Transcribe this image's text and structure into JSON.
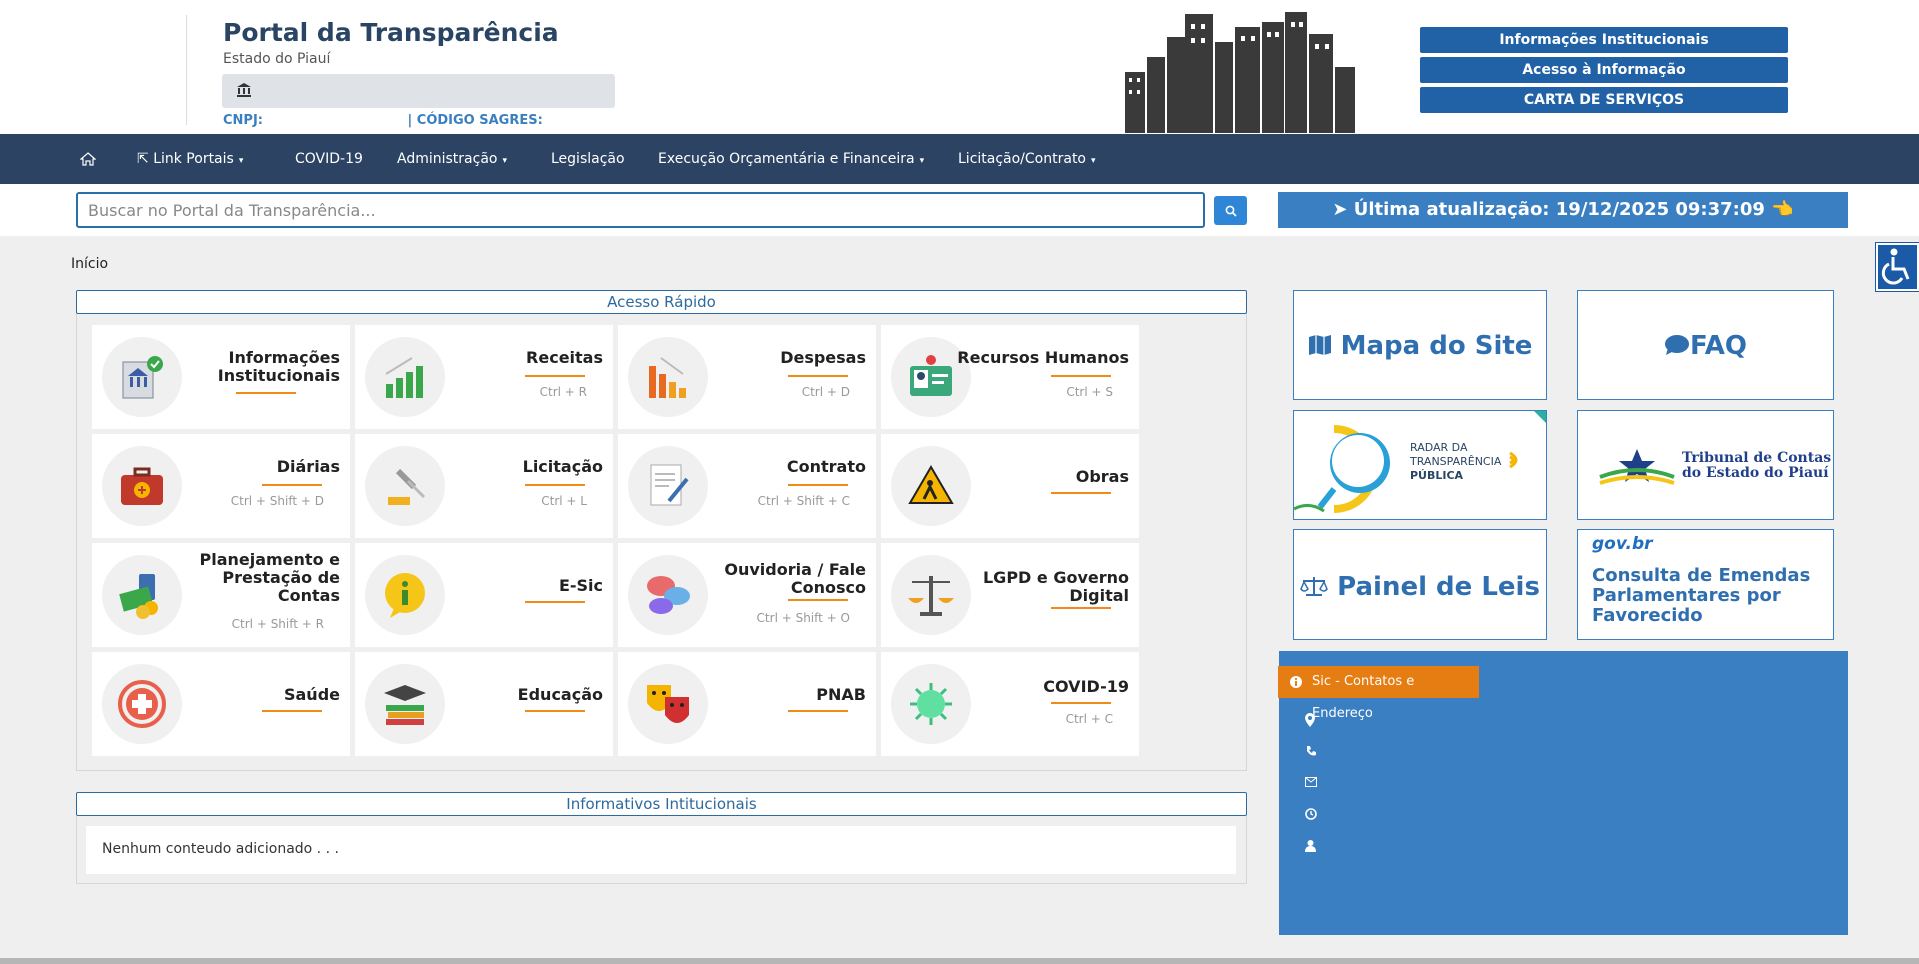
{
  "header": {
    "title": "Portal da Transparência",
    "subtitle": "Estado do Piauí",
    "cnpj_label": "CNPJ:",
    "sagres_label": "| CÓDIGO SAGRES:",
    "buttons": [
      "Informações Institucionais",
      "Acesso à Informação",
      "CARTA DE SERVIÇOS"
    ]
  },
  "nav": {
    "items": [
      {
        "label": "Link Portais"
      },
      {
        "label": "COVID-19"
      },
      {
        "label": "Administração"
      },
      {
        "label": "Legislação"
      },
      {
        "label": "Execução Orçamentária e Financeira"
      },
      {
        "label": "Licitação/Contrato"
      }
    ]
  },
  "search": {
    "placeholder": "Buscar no Portal da Transparência...",
    "update_text": "➤ Última atualização: 19/12/2025 09:37:09 👈"
  },
  "breadcrumb": "Início",
  "quick_access": {
    "title": "Acesso Rápido",
    "cards": [
      {
        "label": "Informações Institucionais",
        "shortcut": "",
        "icon": "building-check-icon"
      },
      {
        "label": "Receitas",
        "shortcut": "Ctrl + R",
        "icon": "growth-chart-icon"
      },
      {
        "label": "Despesas",
        "shortcut": "Ctrl + D",
        "icon": "decline-chart-icon"
      },
      {
        "label": "Recursos Humanos",
        "shortcut": "Ctrl + S",
        "icon": "id-badge-icon"
      },
      {
        "label": "Diárias",
        "shortcut": "Ctrl + Shift + D",
        "icon": "suitcase-icon"
      },
      {
        "label": "Licitação",
        "shortcut": "Ctrl + L",
        "icon": "gavel-icon"
      },
      {
        "label": "Contrato",
        "shortcut": "Ctrl + Shift + C",
        "icon": "contract-icon"
      },
      {
        "label": "Obras",
        "shortcut": "",
        "icon": "construction-sign-icon"
      },
      {
        "label": "Planejamento e Prestação de Contas",
        "shortcut": "Ctrl + Shift + R",
        "icon": "money-icon"
      },
      {
        "label": "E-Sic",
        "shortcut": "",
        "icon": "info-bubble-icon"
      },
      {
        "label": "Ouvidoria / Fale Conosco",
        "shortcut": "Ctrl + Shift + O",
        "icon": "chat-bubbles-icon"
      },
      {
        "label": "LGPD e Governo Digital",
        "shortcut": "",
        "icon": "scales-icon"
      },
      {
        "label": "Saúde",
        "shortcut": "",
        "icon": "health-cross-icon"
      },
      {
        "label": "Educação",
        "shortcut": "",
        "icon": "graduation-books-icon"
      },
      {
        "label": "PNAB",
        "shortcut": "",
        "icon": "theater-masks-icon"
      },
      {
        "label": "COVID-19",
        "shortcut": "Ctrl + C",
        "icon": "virus-icon"
      }
    ]
  },
  "informativos": {
    "title": "Informativos Intitucionais",
    "empty": "Nenhum conteudo adicionado . . ."
  },
  "right": {
    "mapa": "Mapa do Site",
    "faq": "FAQ",
    "radar_line1": "RADAR DA",
    "radar_line2": "TRANSPARÊNCIA",
    "radar_line3": "PÚBLICA",
    "tce_line1": "Tribunal de Contas",
    "tce_line2": "do Estado do Piauí",
    "painel": "Painel de Leis",
    "govbr": "gov.br",
    "emendas": "Consulta de Emendas Parlamentares por Favorecido",
    "sic_title": "Sic - Contatos e Endereço"
  },
  "colors": {
    "nav": "#2c4363",
    "accent": "#3a7fc1",
    "orange": "#e57d12"
  }
}
